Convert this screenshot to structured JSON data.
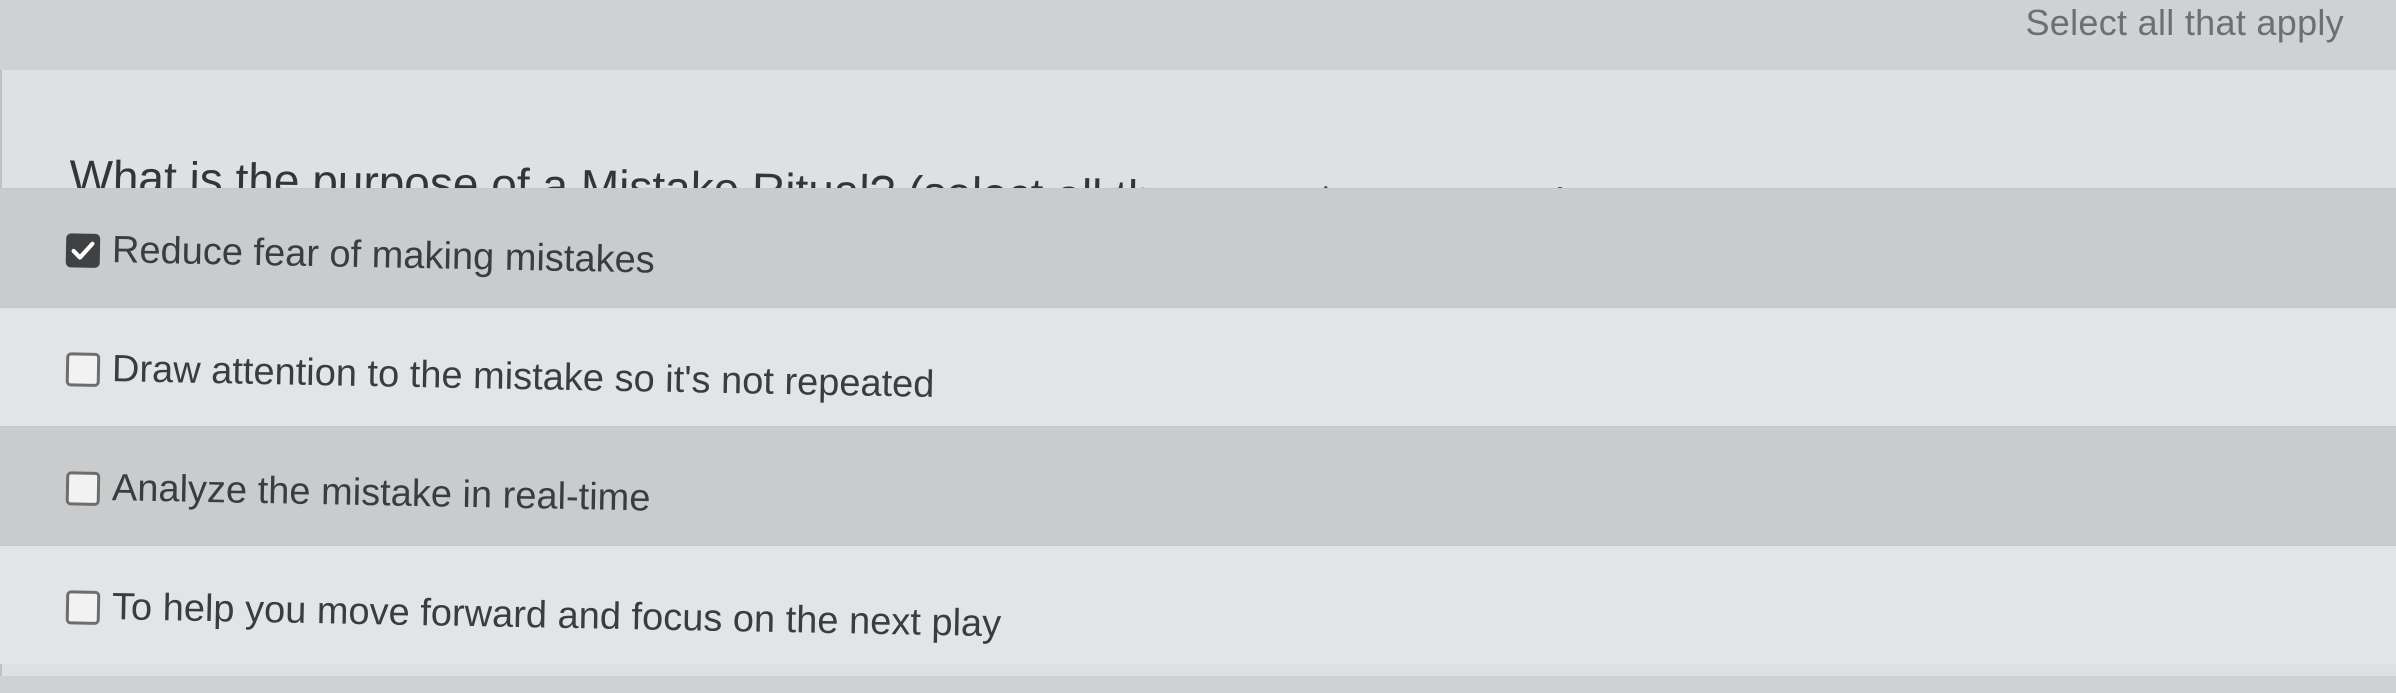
{
  "header": {
    "instruction": "Select all that apply"
  },
  "question": {
    "text": "What is the purpose of a Mistake Ritual? (select all the correct responses)"
  },
  "options": [
    {
      "label": "Reduce fear of making mistakes",
      "checked": true
    },
    {
      "label": "Draw attention to the mistake so it's not repeated",
      "checked": false
    },
    {
      "label": "Analyze the mistake in real-time",
      "checked": false
    },
    {
      "label": "To help you move forward and focus on the next play",
      "checked": false
    }
  ],
  "colors": {
    "checked_fill": "#3f4143",
    "row_dark": "#c9cbcc",
    "row_light": "#e3e4e5"
  },
  "icons": {
    "checked": "checkmark-icon"
  }
}
